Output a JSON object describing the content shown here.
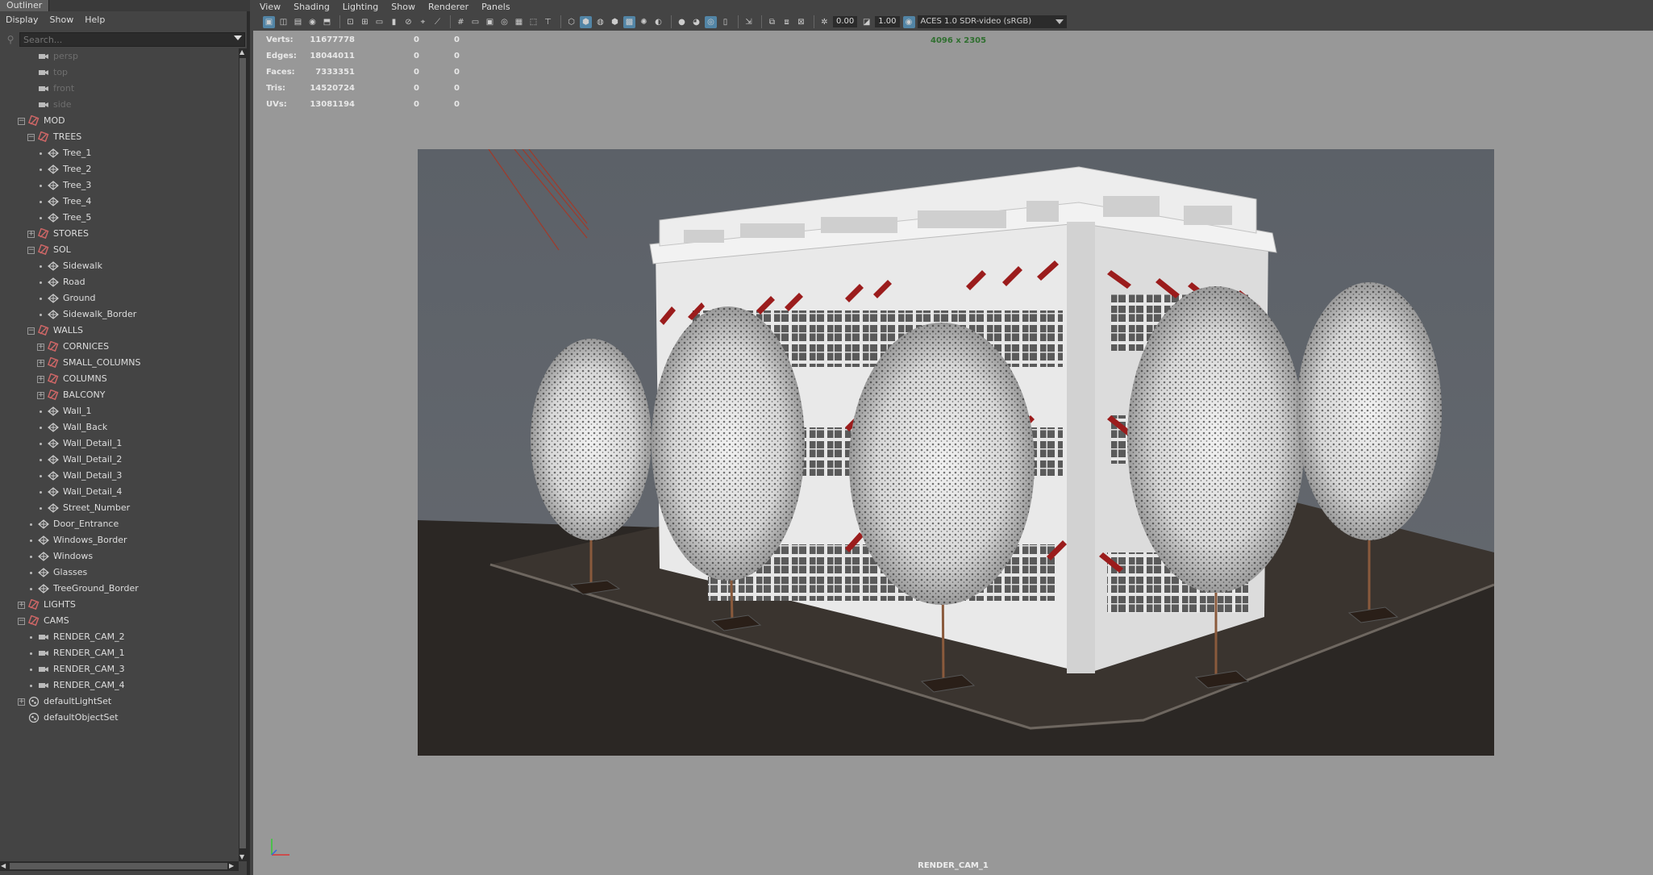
{
  "outliner": {
    "tab": "Outliner",
    "menu": [
      "Display",
      "Show",
      "Help"
    ],
    "search_placeholder": "Search...",
    "items": [
      {
        "label": "persp",
        "dim": true,
        "icon": "camera"
      },
      {
        "label": "top",
        "dim": true,
        "icon": "camera"
      },
      {
        "label": "front",
        "dim": true,
        "icon": "camera"
      },
      {
        "label": "side",
        "dim": true,
        "icon": "camera"
      },
      {
        "label": "MOD",
        "icon": "group"
      },
      {
        "label": "TREES",
        "icon": "group"
      },
      {
        "label": "Tree_1",
        "icon": "mesh"
      },
      {
        "label": "Tree_2",
        "icon": "mesh"
      },
      {
        "label": "Tree_3",
        "icon": "mesh"
      },
      {
        "label": "Tree_4",
        "icon": "mesh"
      },
      {
        "label": "Tree_5",
        "icon": "mesh"
      },
      {
        "label": "STORES",
        "icon": "group"
      },
      {
        "label": "SOL",
        "icon": "group"
      },
      {
        "label": "Sidewalk",
        "icon": "mesh"
      },
      {
        "label": "Road",
        "icon": "mesh"
      },
      {
        "label": "Ground",
        "icon": "mesh"
      },
      {
        "label": "Sidewalk_Border",
        "icon": "mesh"
      },
      {
        "label": "WALLS",
        "icon": "group"
      },
      {
        "label": "CORNICES",
        "icon": "group"
      },
      {
        "label": "SMALL_COLUMNS",
        "icon": "group"
      },
      {
        "label": "COLUMNS",
        "icon": "group"
      },
      {
        "label": "BALCONY",
        "icon": "group"
      },
      {
        "label": "Wall_1",
        "icon": "mesh"
      },
      {
        "label": "Wall_Back",
        "icon": "mesh"
      },
      {
        "label": "Wall_Detail_1",
        "icon": "mesh"
      },
      {
        "label": "Wall_Detail_2",
        "icon": "mesh"
      },
      {
        "label": "Wall_Detail_3",
        "icon": "mesh"
      },
      {
        "label": "Wall_Detail_4",
        "icon": "mesh"
      },
      {
        "label": "Street_Number",
        "icon": "mesh"
      },
      {
        "label": "Door_Entrance",
        "icon": "mesh"
      },
      {
        "label": "Windows_Border",
        "icon": "mesh"
      },
      {
        "label": "Windows",
        "icon": "mesh"
      },
      {
        "label": "Glasses",
        "icon": "mesh"
      },
      {
        "label": "TreeGround_Border",
        "icon": "mesh"
      },
      {
        "label": "LIGHTS",
        "icon": "group"
      },
      {
        "label": "CAMS",
        "icon": "group"
      },
      {
        "label": "RENDER_CAM_2",
        "icon": "camera"
      },
      {
        "label": "RENDER_CAM_1",
        "icon": "camera"
      },
      {
        "label": "RENDER_CAM_3",
        "icon": "camera"
      },
      {
        "label": "RENDER_CAM_4",
        "icon": "camera"
      },
      {
        "label": "defaultLightSet",
        "icon": "set"
      },
      {
        "label": "defaultObjectSet",
        "icon": "set"
      }
    ]
  },
  "viewport": {
    "menu": [
      "View",
      "Shading",
      "Lighting",
      "Show",
      "Renderer",
      "Panels"
    ],
    "exposure": "0.00",
    "gamma": "1.00",
    "color_transform": "ACES 1.0 SDR-video (sRGB)",
    "resolution": "4096 x 2305",
    "camera_name": "RENDER_CAM_1",
    "hud": [
      {
        "label": "Verts:",
        "v1": "11677778",
        "v2": "0",
        "v3": "0"
      },
      {
        "label": "Edges:",
        "v1": "18044011",
        "v2": "0",
        "v3": "0"
      },
      {
        "label": "Faces:",
        "v1": "7333351",
        "v2": "0",
        "v3": "0"
      },
      {
        "label": "Tris:",
        "v1": "14520724",
        "v2": "0",
        "v3": "0"
      },
      {
        "label": "UVs:",
        "v1": "13081194",
        "v2": "0",
        "v3": "0"
      }
    ]
  },
  "colors": {
    "panel": "#444444",
    "viewport_bg": "#989898",
    "render_bg": "#5a5f66",
    "awning": "#9b1c1c",
    "highlight": "#5285a6"
  }
}
